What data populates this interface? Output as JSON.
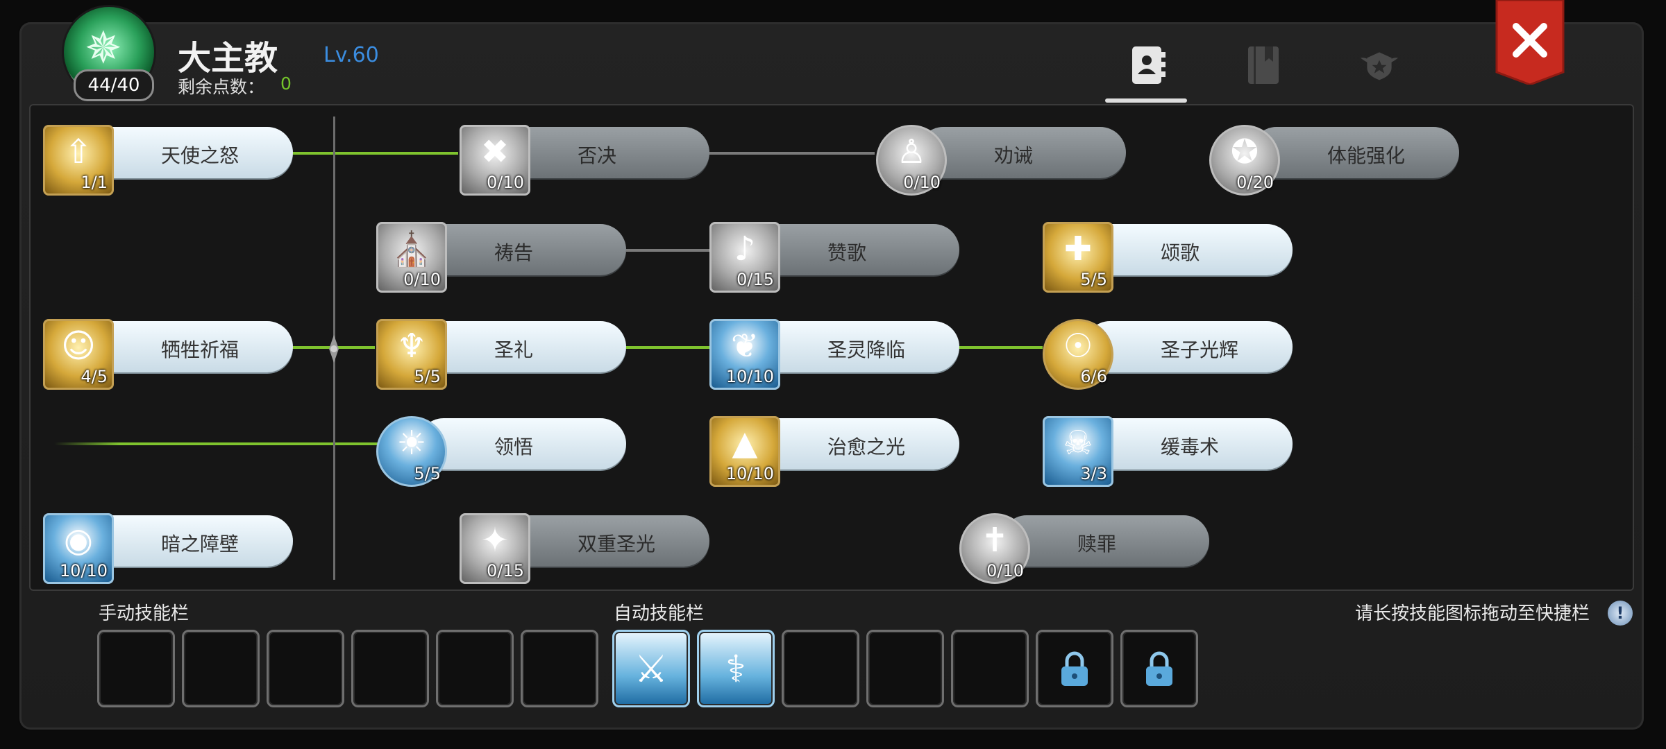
{
  "header": {
    "class_name": "大主教",
    "level": "Lv.60",
    "skill_points_label": "剩余点数：",
    "skill_points_value": "0",
    "emblem_points": "44/40"
  },
  "tabs": [
    {
      "name": "skills",
      "icon": "contact-book-icon",
      "active": true
    },
    {
      "name": "codex",
      "icon": "book-icon",
      "active": false
    },
    {
      "name": "rank",
      "icon": "winged-star-badge-icon",
      "active": false
    }
  ],
  "close_icon": "close-icon",
  "skills": [
    {
      "id": "angel-wrath",
      "name": "天使之怒",
      "count": "1/1",
      "state": "on",
      "icon": "angel-arrow-icon",
      "color": "gold"
    },
    {
      "id": "veto",
      "name": "否决",
      "count": "0/10",
      "state": "off",
      "icon": "x-mark-icon",
      "color": "grey"
    },
    {
      "id": "admonish",
      "name": "劝诫",
      "count": "0/10",
      "state": "off",
      "icon": "kneeling-figure-icon",
      "color": "grey"
    },
    {
      "id": "physique",
      "name": "体能强化",
      "count": "0/20",
      "state": "off",
      "icon": "muscle-shield-icon",
      "color": "grey"
    },
    {
      "id": "prayer",
      "name": "祷告",
      "count": "0/10",
      "state": "off",
      "icon": "praying-hands-icon",
      "color": "grey"
    },
    {
      "id": "hymn",
      "name": "赞歌",
      "count": "0/15",
      "state": "off",
      "icon": "music-note-icon",
      "color": "grey"
    },
    {
      "id": "ode",
      "name": "颂歌",
      "count": "5/5",
      "state": "on",
      "icon": "radiant-cross-icon",
      "color": "gold"
    },
    {
      "id": "sacrifice-bless",
      "name": "牺牲祈福",
      "count": "4/5",
      "state": "on",
      "icon": "angel-spirit-icon",
      "color": "gold"
    },
    {
      "id": "rite",
      "name": "圣礼",
      "count": "5/5",
      "state": "on",
      "icon": "raised-arms-icon",
      "color": "gold"
    },
    {
      "id": "holy-advent",
      "name": "圣灵降临",
      "count": "10/10",
      "state": "on",
      "icon": "angel-wings-icon",
      "color": "blue"
    },
    {
      "id": "holy-child",
      "name": "圣子光辉",
      "count": "6/6",
      "state": "on",
      "icon": "infant-halo-icon",
      "color": "gold"
    },
    {
      "id": "insight",
      "name": "领悟",
      "count": "5/5",
      "state": "on",
      "icon": "lightbulb-icon",
      "color": "blue"
    },
    {
      "id": "heal-light",
      "name": "治愈之光",
      "count": "10/10",
      "state": "on",
      "icon": "light-beam-icon",
      "color": "gold"
    },
    {
      "id": "slow-poison",
      "name": "缓毒术",
      "count": "3/3",
      "state": "on",
      "icon": "stop-skull-icon",
      "color": "blue"
    },
    {
      "id": "dark-barrier",
      "name": "暗之障壁",
      "count": "10/10",
      "state": "on",
      "icon": "barrier-eye-icon",
      "color": "blue"
    },
    {
      "id": "double-holy",
      "name": "双重圣光",
      "count": "0/15",
      "state": "off",
      "icon": "sparkle-icon",
      "color": "grey"
    },
    {
      "id": "atonement",
      "name": "赎罪",
      "count": "0/10",
      "state": "off",
      "icon": "sword-cross-icon",
      "color": "grey"
    }
  ],
  "bars": {
    "manual_label": "手动技能栏",
    "auto_label": "自动技能栏",
    "hint": "请长按技能图标拖动至快捷栏",
    "hint_icon": "info-exclamation-icon",
    "manual_slots": [
      "",
      "",
      "",
      "",
      "",
      ""
    ],
    "auto_slots": [
      {
        "icon": "broken-sword-icon",
        "filled": true
      },
      {
        "icon": "healing-figure-icon",
        "filled": true
      },
      {
        "icon": "",
        "filled": false
      },
      {
        "icon": "",
        "filled": false
      },
      {
        "icon": "",
        "filled": false
      },
      {
        "icon": "lock-icon",
        "locked": true
      },
      {
        "icon": "lock-icon",
        "locked": true
      }
    ]
  },
  "colors": {
    "connector_active": "#7fc32e",
    "connector_inactive": "#7a7a7a",
    "level_text": "#3b8de0"
  }
}
